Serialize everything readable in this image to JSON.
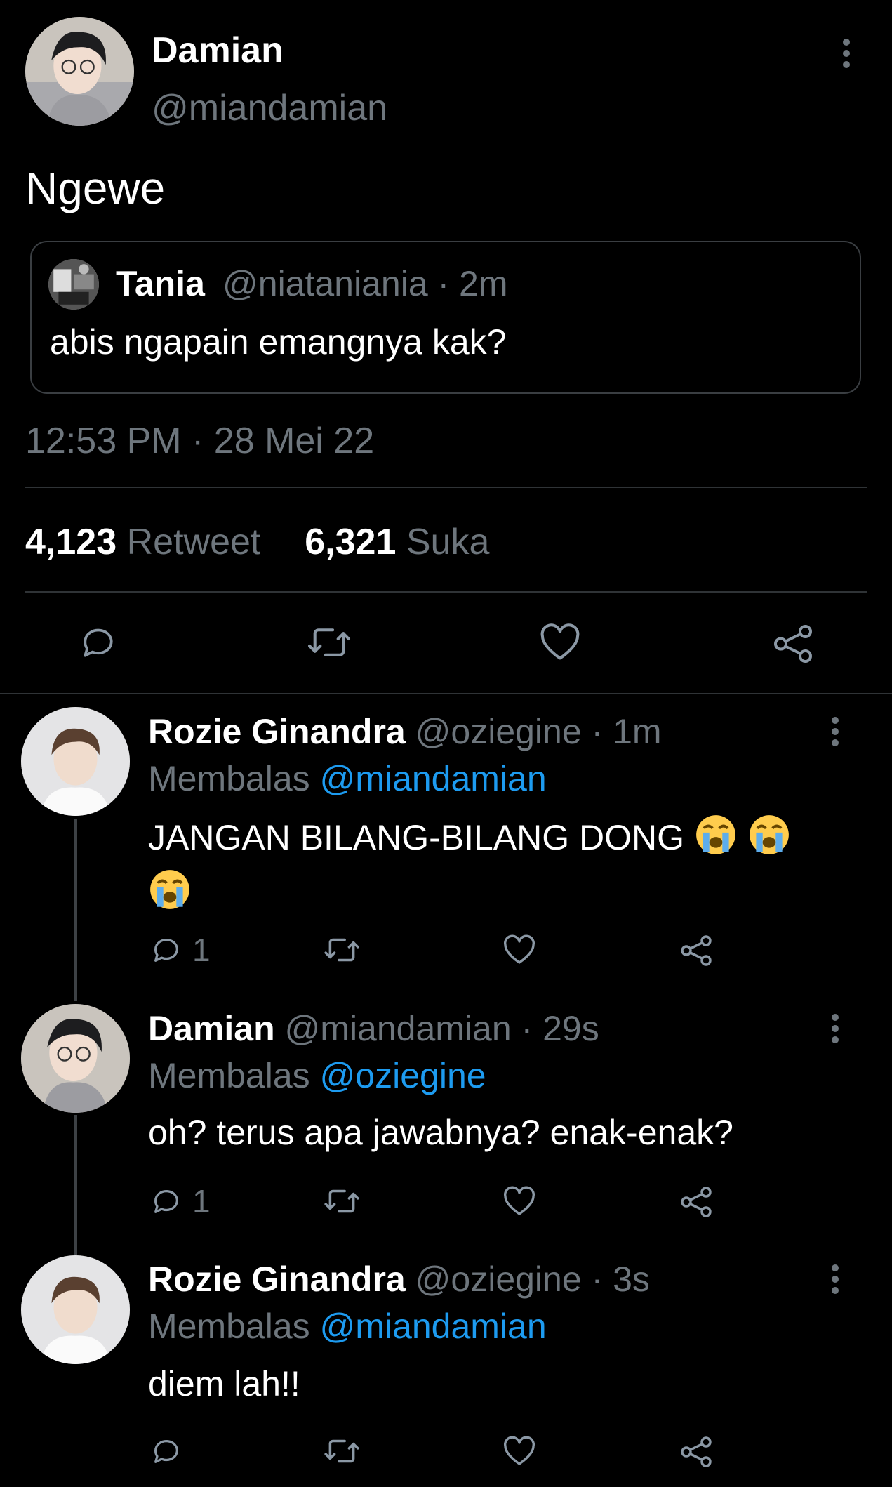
{
  "main_tweet": {
    "author_name": "Damian",
    "author_handle": "@miandamian",
    "text": "Ngewe",
    "quoted": {
      "author_name": "Tania",
      "meta": "@niataniania · 2m",
      "text": "abis ngapain emangnya kak?"
    },
    "timestamp": "12:53 PM · 28 Mei 22",
    "retweets_count": "4,123",
    "retweets_label": "Retweet",
    "likes_count": "6,321",
    "likes_label": "Suka"
  },
  "replies": [
    {
      "author_name": "Rozie Ginandra",
      "meta": "@oziegine · 1m",
      "replying_label": "Membalas",
      "replying_to": "@miandamian",
      "text_line1": "JANGAN BILANG-BILANG DONG",
      "reply_count": "1"
    },
    {
      "author_name": "Damian",
      "meta": "@miandamian · 29s",
      "replying_label": "Membalas",
      "replying_to": "@oziegine",
      "text_line1": "oh? terus apa jawabnya? enak-enak?",
      "reply_count": "1"
    },
    {
      "author_name": "Rozie Ginandra",
      "meta": "@oziegine · 3s",
      "replying_label": "Membalas",
      "replying_to": "@miandamian",
      "text_line1": "diem lah!!",
      "reply_count": ""
    }
  ],
  "colors": {
    "background": "#000000",
    "muted": "#6e767d",
    "link": "#1d9bf0",
    "divider": "#2f3336"
  },
  "icons": [
    "more-icon",
    "reply-icon",
    "retweet-icon",
    "like-icon",
    "share-icon",
    "crying-emoji-icon"
  ]
}
